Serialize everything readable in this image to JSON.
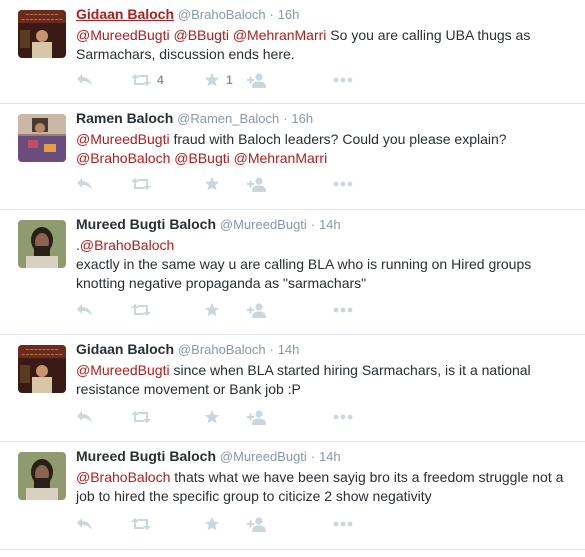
{
  "tweets": [
    {
      "fullname": "Gidaan Baloch",
      "handle": "@BrahoBaloch",
      "sep": "·",
      "time": "16h",
      "line1": [
        {
          "t": "@MureedBugti",
          "m": true
        },
        {
          "t": " ",
          "m": false
        },
        {
          "t": "@BBugti",
          "m": true
        },
        {
          "t": " ",
          "m": false
        },
        {
          "t": "@MehranMarri",
          "m": true
        },
        {
          "t": " So you are calling UBA thugs as",
          "m": false
        }
      ],
      "line2": [
        {
          "t": "Sarmachars, discussion ends here.",
          "m": false
        }
      ],
      "retweet_count": "4",
      "favorite_count": "1"
    },
    {
      "fullname": "Ramen Baloch",
      "handle": "@Ramen_Baloch",
      "sep": "·",
      "time": "16h",
      "line1": [
        {
          "t": "@MureedBugti",
          "m": true
        },
        {
          "t": " fraud with Baloch leaders? Could you please explain?",
          "m": false
        }
      ],
      "line2": [
        {
          "t": "@BrahoBaloch",
          "m": true
        },
        {
          "t": " ",
          "m": false
        },
        {
          "t": "@BBugti",
          "m": true
        },
        {
          "t": " ",
          "m": false
        },
        {
          "t": "@MehranMarri",
          "m": true
        }
      ]
    },
    {
      "fullname": "Mureed Bugti Baloch",
      "handle": "@MureedBugti",
      "sep": "·",
      "time": "14h",
      "line1": [
        {
          "t": ".",
          "m": false
        },
        {
          "t": "@BrahoBaloch",
          "m": true
        }
      ],
      "line2": [
        {
          "t": "exactly in the same way u are calling BLA who is running on Hired groups",
          "m": false
        }
      ],
      "line3": [
        {
          "t": "knotting negative propaganda as \"sarmachars\"",
          "m": false
        }
      ]
    },
    {
      "fullname": "Gidaan Baloch",
      "handle": "@BrahoBaloch",
      "sep": "·",
      "time": "14h",
      "line1": [
        {
          "t": "@MureedBugti",
          "m": true
        },
        {
          "t": " since when BLA started hiring Sarmachars, is it a national",
          "m": false
        }
      ],
      "line2": [
        {
          "t": "resistance movement or Bank job :P",
          "m": false
        }
      ]
    },
    {
      "fullname": "Mureed Bugti Baloch",
      "handle": "@MureedBugti",
      "sep": "·",
      "time": "14h",
      "line1": [
        {
          "t": "@BrahoBaloch",
          "m": true
        },
        {
          "t": " thats what we have been sayig bro its a freedom struggle not a",
          "m": false
        }
      ],
      "line2": [
        {
          "t": "job to hired the specific group  to citicize 2 show negativity",
          "m": false
        }
      ]
    }
  ],
  "colors": {
    "mention": "#b21d1d",
    "name_hover": "#b21d1d",
    "meta": "#8899a6",
    "icon": "#ccd6dd",
    "divider": "#e1e8ed"
  },
  "icons": {
    "reply": "reply-icon",
    "retweet": "retweet-icon",
    "favorite": "star-icon",
    "follow": "follow-icon",
    "more": "more-icon"
  }
}
